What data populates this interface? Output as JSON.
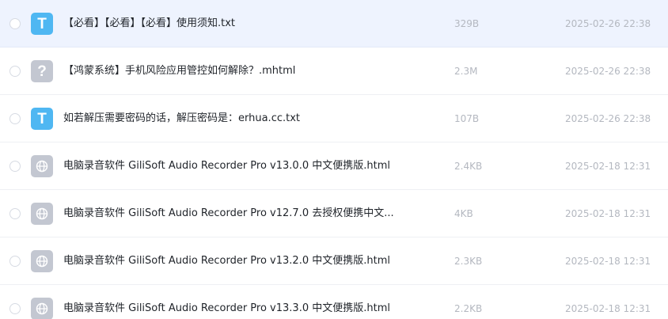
{
  "colors": {
    "txt_icon": "#4fb7f2",
    "generic_icon": "#c3c7d1",
    "selected_row": "#eef3fe"
  },
  "files": [
    {
      "name": "【必看】【必看】【必看】使用须知.txt",
      "size": "329B",
      "date": "2025-02-26 22:38",
      "icon": "txt-file-icon",
      "glyph": "T"
    },
    {
      "name": "【鸿蒙系统】手机风险应用管控如何解除？.mhtml",
      "size": "2.3M",
      "date": "2025-02-26 22:38",
      "icon": "unknown-file-icon",
      "glyph": "?"
    },
    {
      "name": "如若解压需要密码的话，解压密码是：erhua.cc.txt",
      "size": "107B",
      "date": "2025-02-26 22:38",
      "icon": "txt-file-icon",
      "glyph": "T"
    },
    {
      "name": "电脑录音软件 GiliSoft Audio Recorder Pro v13.0.0 中文便携版.html",
      "size": "2.4KB",
      "date": "2025-02-18 12:31",
      "icon": "globe-icon",
      "glyph": ""
    },
    {
      "name": "电脑录音软件 GiliSoft Audio Recorder Pro v12.7.0 去授权便携中文...",
      "size": "4KB",
      "date": "2025-02-18 12:31",
      "icon": "globe-icon",
      "glyph": ""
    },
    {
      "name": "电脑录音软件 GiliSoft Audio Recorder Pro v13.2.0 中文便携版.html",
      "size": "2.3KB",
      "date": "2025-02-18 12:31",
      "icon": "globe-icon",
      "glyph": ""
    },
    {
      "name": "电脑录音软件 GiliSoft Audio Recorder Pro v13.3.0 中文便携版.html",
      "size": "2.2KB",
      "date": "2025-02-18 12:31",
      "icon": "globe-icon",
      "glyph": ""
    }
  ]
}
